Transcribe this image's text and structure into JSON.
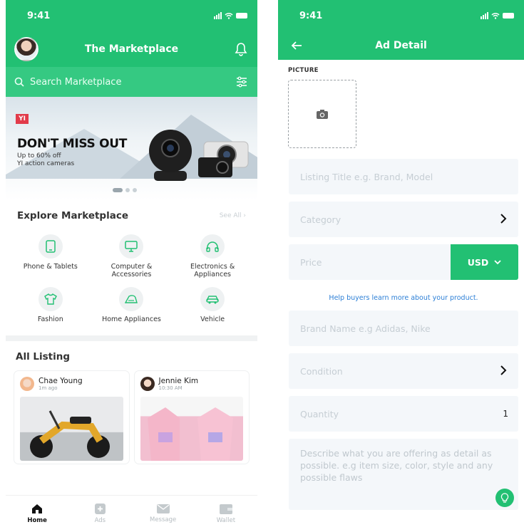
{
  "left": {
    "status_time": "9:41",
    "header_title": "The Marketplace",
    "search_placeholder": "Search Marketplace",
    "banner": {
      "brand": "YI",
      "headline": "DON'T MISS OUT",
      "subline1": "Up to 60% off",
      "subline2": "YI action cameras"
    },
    "explore": {
      "title": "Explore Marketplace",
      "see_all": "See All",
      "categories": [
        {
          "label": "Phone & Tablets",
          "icon": "phone-icon"
        },
        {
          "label": "Computer &\nAccessories",
          "icon": "computer-icon"
        },
        {
          "label": "Electronics &\nAppliances",
          "icon": "headphones-icon"
        },
        {
          "label": "Fashion",
          "icon": "shirt-icon"
        },
        {
          "label": "Home Appliances",
          "icon": "iron-icon"
        },
        {
          "label": "Vehicle",
          "icon": "car-icon"
        }
      ]
    },
    "listing": {
      "title": "All Listing",
      "items": [
        {
          "name": "Chae Young",
          "time": "1m ago"
        },
        {
          "name": "Jennie Kim",
          "time": "10:30 AM"
        }
      ]
    },
    "tabs": [
      {
        "label": "Home",
        "icon": "home-icon",
        "active": true
      },
      {
        "label": "Ads",
        "icon": "plus-icon",
        "active": false
      },
      {
        "label": "Message",
        "icon": "mail-icon",
        "active": false
      },
      {
        "label": "Wallet",
        "icon": "wallet-icon",
        "active": false
      }
    ]
  },
  "right": {
    "status_time": "9:41",
    "header_title": "Ad Detail",
    "picture_label": "PICTURE",
    "fields": {
      "title_placeholder": "Listing Title e.g. Brand, Model",
      "category_placeholder": "Category",
      "price_placeholder": "Price",
      "currency": "USD",
      "help_text": "Help buyers learn more about your product.",
      "brand_placeholder": "Brand Name e.g Adidas, Nike",
      "condition_placeholder": "Condition",
      "quantity_label": "Quantity",
      "quantity_value": "1",
      "description_placeholder": "Describe what you are offering as detail as possible. e.g item size, color, style and any possible flaws"
    }
  },
  "colors": {
    "primary": "#22c073",
    "link": "#2c7fd6",
    "field_bg": "#f4f7fa"
  }
}
